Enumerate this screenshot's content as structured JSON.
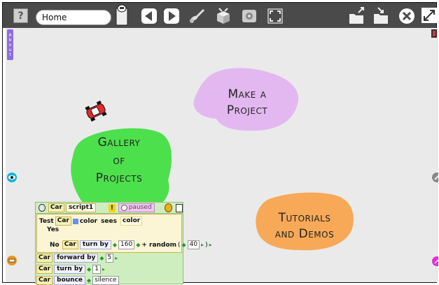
{
  "toolbar": {
    "help_label": "?",
    "project_name": "Home",
    "icons": [
      "document-icon",
      "back-icon",
      "forward-icon",
      "paint-icon",
      "supplies-icon",
      "sound-icon",
      "fullscreen-icon",
      "open-icon",
      "save-icon",
      "close-icon",
      "expand-icon"
    ]
  },
  "flaps": {
    "about_letters": [
      "A",
      "b",
      "o",
      "u",
      "t"
    ]
  },
  "blobs": {
    "make": [
      "Make a",
      "Project"
    ],
    "gallery": [
      "Gallery",
      "of",
      "Projects"
    ],
    "tutorials": [
      "Tutorials",
      "and Demos"
    ]
  },
  "colors": {
    "make_blob": "#e3b8f0",
    "gallery_blob": "#4de04d",
    "tutorials_blob": "#f7a957",
    "toolbar": "#4a4a4a",
    "world": "#eaeaea",
    "script_bg": "#cfeec0"
  },
  "script": {
    "object": "Car",
    "name": "script1",
    "status": "paused",
    "test_label": "Test",
    "test_obj": "Car",
    "test_color_word": "color",
    "test_sees": "sees",
    "test_color2": "color",
    "yes_label": "Yes",
    "no_label": "No",
    "no_obj": "Car",
    "no_cmd": "turn by",
    "no_val": "160",
    "no_plus": "+ random",
    "no_paren_open": "(",
    "no_rand": "40",
    "no_paren_close": ")",
    "rows": [
      {
        "obj": "Car",
        "cmd": "forward by",
        "val": "5"
      },
      {
        "obj": "Car",
        "cmd": "turn by",
        "val": "1"
      },
      {
        "obj": "Car",
        "cmd": "bounce",
        "val": "silence"
      }
    ]
  }
}
